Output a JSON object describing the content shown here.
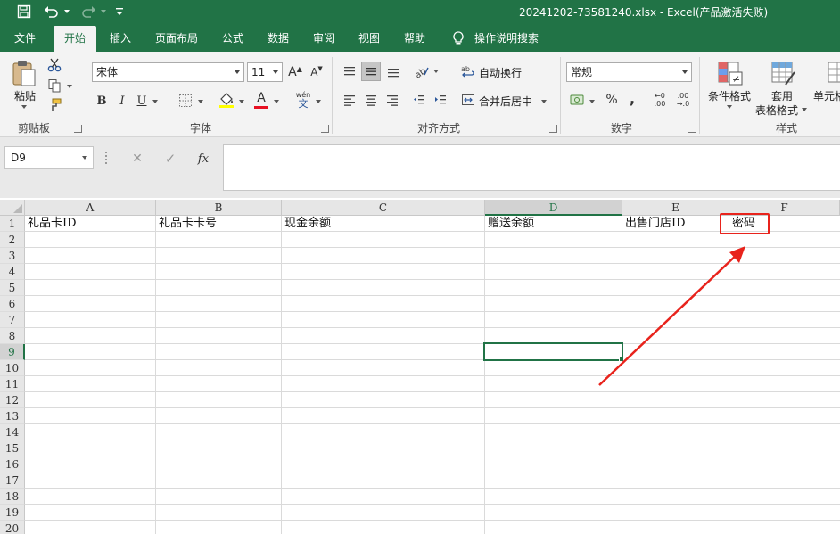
{
  "title": "20241202-73581240.xlsx  -  Excel(产品激活失败)",
  "tabs": [
    "文件",
    "开始",
    "插入",
    "页面布局",
    "公式",
    "数据",
    "审阅",
    "视图",
    "帮助"
  ],
  "tell_me": "操作说明搜索",
  "ribbon": {
    "paste_label": "粘贴",
    "clipboard_label": "剪贴板",
    "font_name": "宋体",
    "font_size": "11",
    "font_group_label": "字体",
    "bold": "B",
    "italic": "I",
    "underline": "U",
    "font_color_letter": "A",
    "wen": "wén",
    "wen_char": "文",
    "grow_font": "A",
    "shrink_font": "A",
    "wrap_text": "自动换行",
    "merge_center": "合并后居中",
    "align_group_label": "对齐方式",
    "number_format": "常规",
    "percent": "%",
    "comma": ",",
    "inc_decimal_top": "←0",
    "inc_decimal_bottom": ".00",
    "dec_decimal_top": ".00",
    "dec_decimal_bottom": "→.0",
    "number_group_label": "数字",
    "cond_format": "条件格式",
    "table_format_1": "套用",
    "table_format_2": "表格格式",
    "cell_styles": "单元格",
    "styles_group_label": "样式"
  },
  "formula_bar": {
    "name_box": "D9",
    "cancel": "✕",
    "confirm": "✓",
    "fx": "fx",
    "value": ""
  },
  "columns": [
    "A",
    "B",
    "C",
    "D",
    "E",
    "F"
  ],
  "rows": [
    "1",
    "2",
    "3",
    "4",
    "5",
    "6",
    "7",
    "8",
    "9",
    "10",
    "11",
    "12",
    "13",
    "14",
    "15",
    "16",
    "17",
    "18",
    "19",
    "20"
  ],
  "cells": {
    "A1": "礼品卡ID",
    "B1": "礼品卡卡号",
    "C1": "现金余额",
    "D1": "赠送余额",
    "E1": "出售门店ID",
    "F1": "密码"
  },
  "colors": {
    "accent": "#217346",
    "annotation": "#e8231c"
  }
}
